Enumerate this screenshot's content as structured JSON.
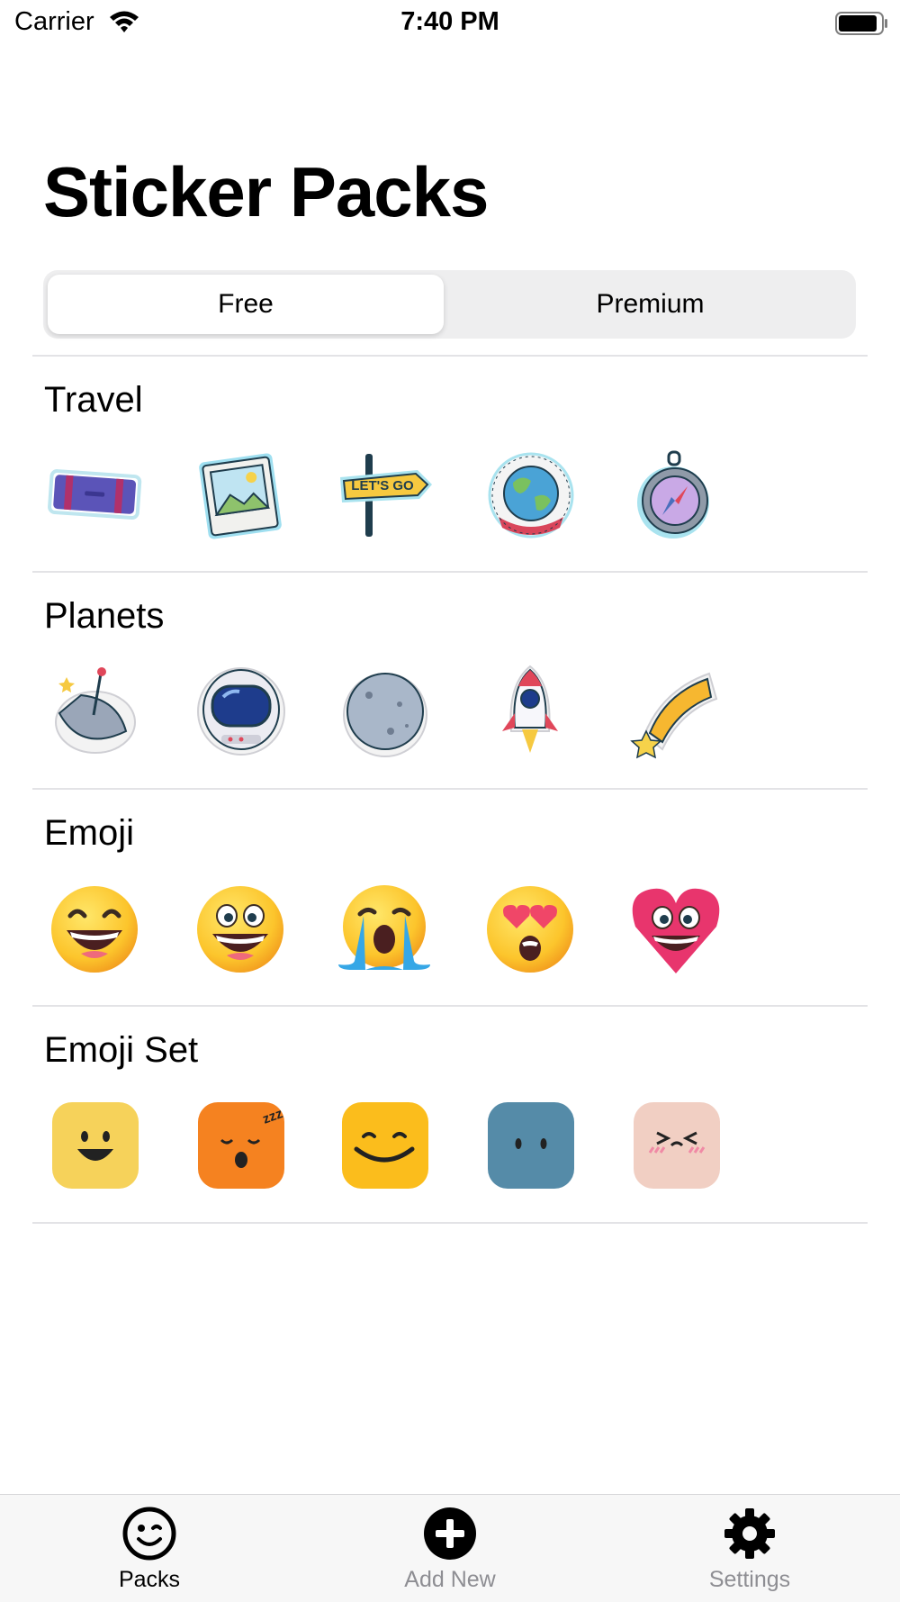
{
  "status_bar": {
    "carrier": "Carrier",
    "time": "7:40 PM"
  },
  "page_title": "Sticker Packs",
  "segmented_control": {
    "options": [
      "Free",
      "Premium"
    ],
    "selected": "Free"
  },
  "packs": [
    {
      "title": "Travel",
      "stickers": [
        "suitcase-sticker",
        "photo-frame-sticker",
        "lets-go-signpost-sticker",
        "travel-around-the-world-globe-sticker",
        "compass-sticker"
      ],
      "sign_text": "LET'S GO"
    },
    {
      "title": "Planets",
      "stickers": [
        "satellite-dish-sticker",
        "astronaut-helmet-sticker",
        "moon-sticker",
        "rocket-sticker",
        "shooting-star-sticker"
      ]
    },
    {
      "title": "Emoji",
      "stickers": [
        "grinning-squinting-face",
        "grinning-face-big-eyes",
        "loudly-crying-face",
        "heart-eyes-face",
        "smiling-heart-face"
      ]
    },
    {
      "title": "Emoji Set",
      "stickers": [
        "happy-yellow-square",
        "sleepy-orange-square",
        "smiling-yellow-square",
        "neutral-blue-square",
        "squinting-pink-square"
      ],
      "zzz_text": "zzz"
    }
  ],
  "tab_bar": {
    "tabs": [
      {
        "label": "Packs",
        "icon": "smiley-wink-icon",
        "active": true
      },
      {
        "label": "Add New",
        "icon": "plus-circle-icon",
        "active": false
      },
      {
        "label": "Settings",
        "icon": "gear-icon",
        "active": false
      }
    ]
  },
  "colors": {
    "segment_bg": "#eeeeef",
    "divider": "#e3e3e6",
    "inactive_tab": "#8e8e93",
    "tab_bar_bg": "#f7f7f7"
  }
}
